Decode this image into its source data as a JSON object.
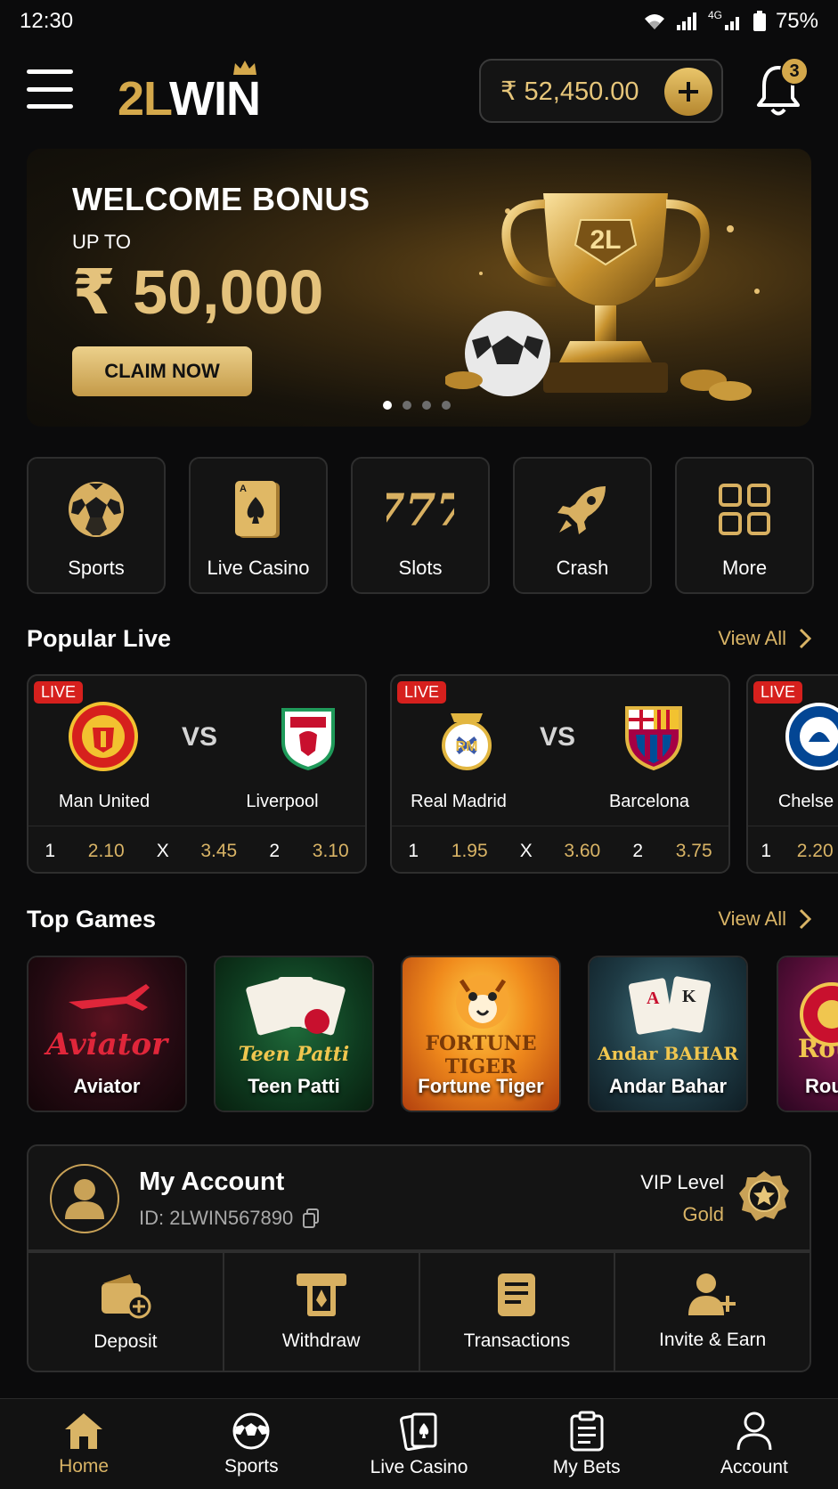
{
  "status_bar": {
    "time": "12:30",
    "battery": "75%",
    "network": "4G"
  },
  "header": {
    "logo_part1": "2L",
    "logo_part2": "WIN",
    "balance": "₹ 52,450.00",
    "notifications_count": "3"
  },
  "banner": {
    "title": "WELCOME BONUS",
    "subtitle": "UP TO",
    "amount": "₹ 50,000",
    "cta": "CLAIM NOW",
    "trophy_text": "2L",
    "slides": 4,
    "active_slide": 1
  },
  "categories": [
    {
      "label": "Sports",
      "icon": "soccer-ball-icon"
    },
    {
      "label": "Live Casino",
      "icon": "playing-card-icon"
    },
    {
      "label": "Slots",
      "icon": "slots-777-icon"
    },
    {
      "label": "Crash",
      "icon": "rocket-icon"
    },
    {
      "label": "More",
      "icon": "grid-icon"
    }
  ],
  "popular_live": {
    "title": "Popular Live",
    "view_all": "View All",
    "matches": [
      {
        "badge": "LIVE",
        "home": "Man United",
        "away": "Liverpool",
        "vs": "VS",
        "o1k": "1",
        "o1": "2.10",
        "oxk": "X",
        "ox": "3.45",
        "o2k": "2",
        "o2": "3.10"
      },
      {
        "badge": "LIVE",
        "home": "Real Madrid",
        "away": "Barcelona",
        "vs": "VS",
        "o1k": "1",
        "o1": "1.95",
        "oxk": "X",
        "ox": "3.60",
        "o2k": "2",
        "o2": "3.75"
      },
      {
        "badge": "LIVE",
        "home": "Chelse",
        "o1k": "1",
        "o1": "2.20"
      }
    ]
  },
  "top_games": {
    "title": "Top Games",
    "view_all": "View All",
    "games": [
      {
        "label": "Aviator",
        "logo": "Aviator"
      },
      {
        "label": "Teen Patti",
        "logo": "Teen Patti"
      },
      {
        "label": "Fortune Tiger",
        "logo": "FORTUNE TIGER"
      },
      {
        "label": "Andar Bahar",
        "logo": "Andar BAHAR"
      },
      {
        "label": "Rou",
        "logo": "Rou"
      }
    ]
  },
  "account": {
    "title": "My Account",
    "id": "ID: 2LWIN567890",
    "vip_label": "VIP Level",
    "vip_value": "Gold",
    "actions": [
      {
        "label": "Deposit",
        "icon": "wallet-plus-icon"
      },
      {
        "label": "Withdraw",
        "icon": "atm-withdraw-icon"
      },
      {
        "label": "Transactions",
        "icon": "document-icon"
      },
      {
        "label": "Invite & Earn",
        "icon": "user-plus-icon"
      }
    ]
  },
  "bottom_nav": [
    {
      "label": "Home",
      "icon": "home-icon",
      "active": true
    },
    {
      "label": "Sports",
      "icon": "soccer-ball-icon",
      "active": false
    },
    {
      "label": "Live Casino",
      "icon": "cards-icon",
      "active": false
    },
    {
      "label": "My Bets",
      "icon": "clipboard-icon",
      "active": false
    },
    {
      "label": "Account",
      "icon": "user-icon",
      "active": false
    }
  ],
  "colors": {
    "gold": "#d9b466",
    "live_red": "#d6201d",
    "background": "#0b0b0c",
    "card": "#141414"
  }
}
